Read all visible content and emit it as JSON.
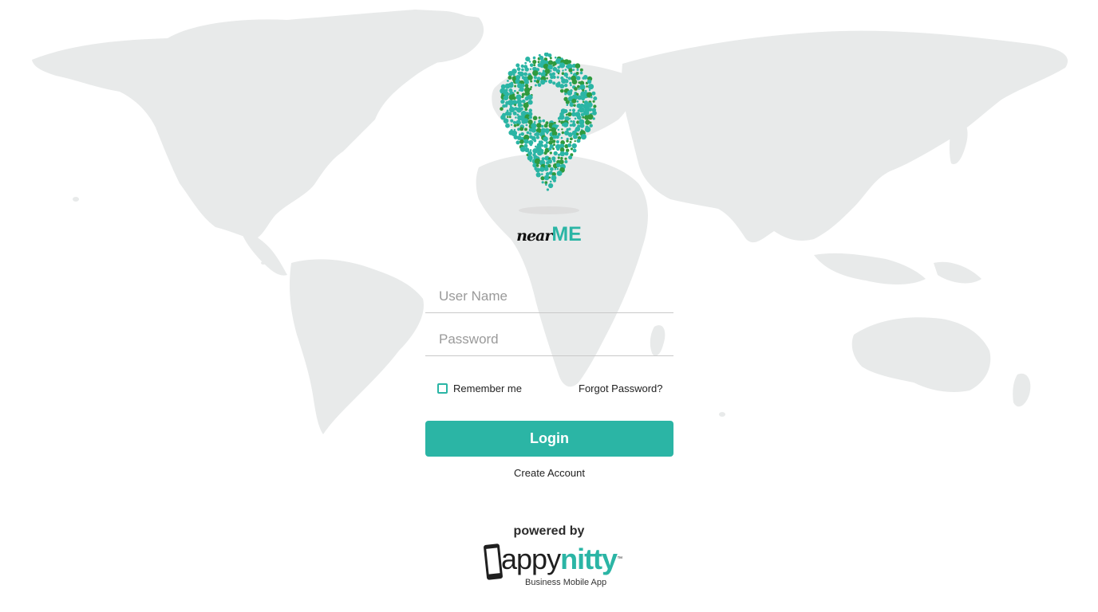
{
  "brand": {
    "name_part1": "near",
    "name_part2": "ME",
    "accent_color": "#2bb5a5",
    "secondary_color": "#2f9a3e"
  },
  "login_form": {
    "username_placeholder": "User Name",
    "password_placeholder": "Password",
    "remember_label": "Remember me",
    "remember_checked": false,
    "forgot_label": "Forgot Password?",
    "login_label": "Login",
    "create_account_label": "Create Account"
  },
  "footer": {
    "powered_by": "powered by",
    "company_part1": "appy",
    "company_part2": "nitty",
    "trademark": "™",
    "tagline": "Business Mobile App"
  },
  "background": {
    "image": "world-map",
    "map_color": "#e8eaea"
  },
  "icons": [
    "location-pin-icon",
    "phone-icon",
    "checkbox-icon"
  ]
}
